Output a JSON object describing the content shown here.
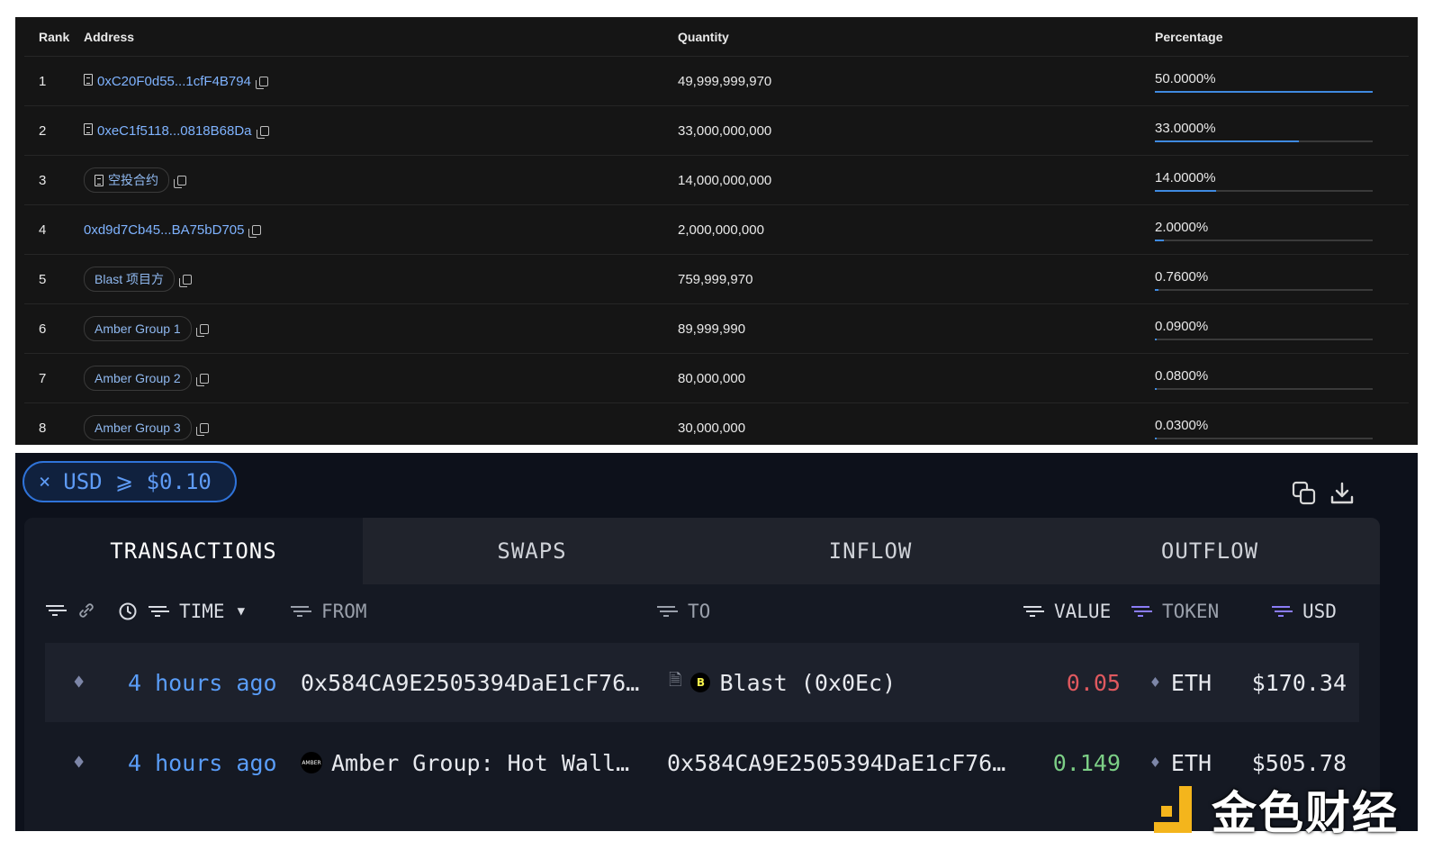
{
  "holders": {
    "headers": {
      "rank": "Rank",
      "address": "Address",
      "quantity": "Quantity",
      "percentage": "Percentage"
    },
    "rows": [
      {
        "rank": "1",
        "address": "0xC20F0d55...1cfF4B794",
        "tag": false,
        "contract": true,
        "quantity": "49,999,999,970",
        "percentage": "50.0000%",
        "pct": 50.0
      },
      {
        "rank": "2",
        "address": "0xeC1f5118...0818B68Da",
        "tag": false,
        "contract": true,
        "quantity": "33,000,000,000",
        "percentage": "33.0000%",
        "pct": 33.0
      },
      {
        "rank": "3",
        "address": "空投合约",
        "tag": true,
        "contract": true,
        "quantity": "14,000,000,000",
        "percentage": "14.0000%",
        "pct": 14.0
      },
      {
        "rank": "4",
        "address": "0xd9d7Cb45...BA75bD705",
        "tag": false,
        "contract": false,
        "quantity": "2,000,000,000",
        "percentage": "2.0000%",
        "pct": 2.0
      },
      {
        "rank": "5",
        "address": "Blast 项目方",
        "tag": true,
        "contract": false,
        "quantity": "759,999,970",
        "percentage": "0.7600%",
        "pct": 0.76
      },
      {
        "rank": "6",
        "address": "Amber Group 1",
        "tag": true,
        "contract": false,
        "quantity": "89,999,990",
        "percentage": "0.0900%",
        "pct": 0.09
      },
      {
        "rank": "7",
        "address": "Amber Group 2",
        "tag": true,
        "contract": false,
        "quantity": "80,000,000",
        "percentage": "0.0800%",
        "pct": 0.08
      },
      {
        "rank": "8",
        "address": "Amber Group 3",
        "tag": true,
        "contract": false,
        "quantity": "30,000,000",
        "percentage": "0.0300%",
        "pct": 0.03
      }
    ]
  },
  "transactions": {
    "filter_chip": {
      "close": "×",
      "label": "USD ⩾ $0.10"
    },
    "tabs": [
      "TRANSACTIONS",
      "SWAPS",
      "INFLOW",
      "OUTFLOW"
    ],
    "columns": {
      "time": "TIME",
      "from": "FROM",
      "to": "TO",
      "value": "VALUE",
      "token": "TOKEN",
      "usd": "USD"
    },
    "rows": [
      {
        "time": "4 hours ago",
        "from": "0x584CA9E2505394DaE1cF76…",
        "to": "Blast (0x0Ec)",
        "value": "0.05",
        "token": "ETH",
        "usd": "$170.34"
      },
      {
        "time": "4 hours ago",
        "from": "Amber Group: Hot Wall…",
        "to": "0x584CA9E2505394DaE1cF76…",
        "value": "0.149",
        "token": "ETH",
        "usd": "$505.78"
      }
    ],
    "logos": {
      "blast": "B",
      "amber": "AMBER"
    }
  },
  "watermark": {
    "text": "金色财经"
  },
  "colors": {
    "accent": "#3f8ae0",
    "link": "#7fb3ff",
    "negative": "#e0595f",
    "positive": "#7ccf86",
    "time": "#5a9df8"
  }
}
